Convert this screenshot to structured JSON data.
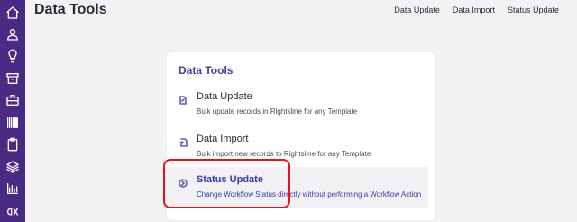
{
  "header": {
    "title": "Data Tools",
    "links": [
      "Data Update",
      "Data Import",
      "Status Update"
    ]
  },
  "sidebar": {
    "icons": [
      "home-icon",
      "user-icon",
      "lightbulb-icon",
      "archive-icon",
      "briefcase-icon",
      "barcode-icon",
      "clipboard-icon",
      "layers-icon",
      "bar-chart-icon",
      "brand-logo-icon"
    ]
  },
  "card": {
    "title": "Data Tools",
    "items": [
      {
        "label": "Data Update",
        "description": "Bulk update records in Rightsline for any Template",
        "icon": "file-edit-icon"
      },
      {
        "label": "Data Import",
        "description": "Bulk import new records to Rightsline for any Template",
        "icon": "file-import-icon"
      },
      {
        "label": "Status Update",
        "description": "Change Workflow Status directly without performing a Workflow Action",
        "icon": "circle-chevron-right-icon"
      }
    ]
  },
  "colors": {
    "sidebar": "#4b2a84",
    "accent": "#3b3aa8",
    "highlight": "#e3121f"
  }
}
